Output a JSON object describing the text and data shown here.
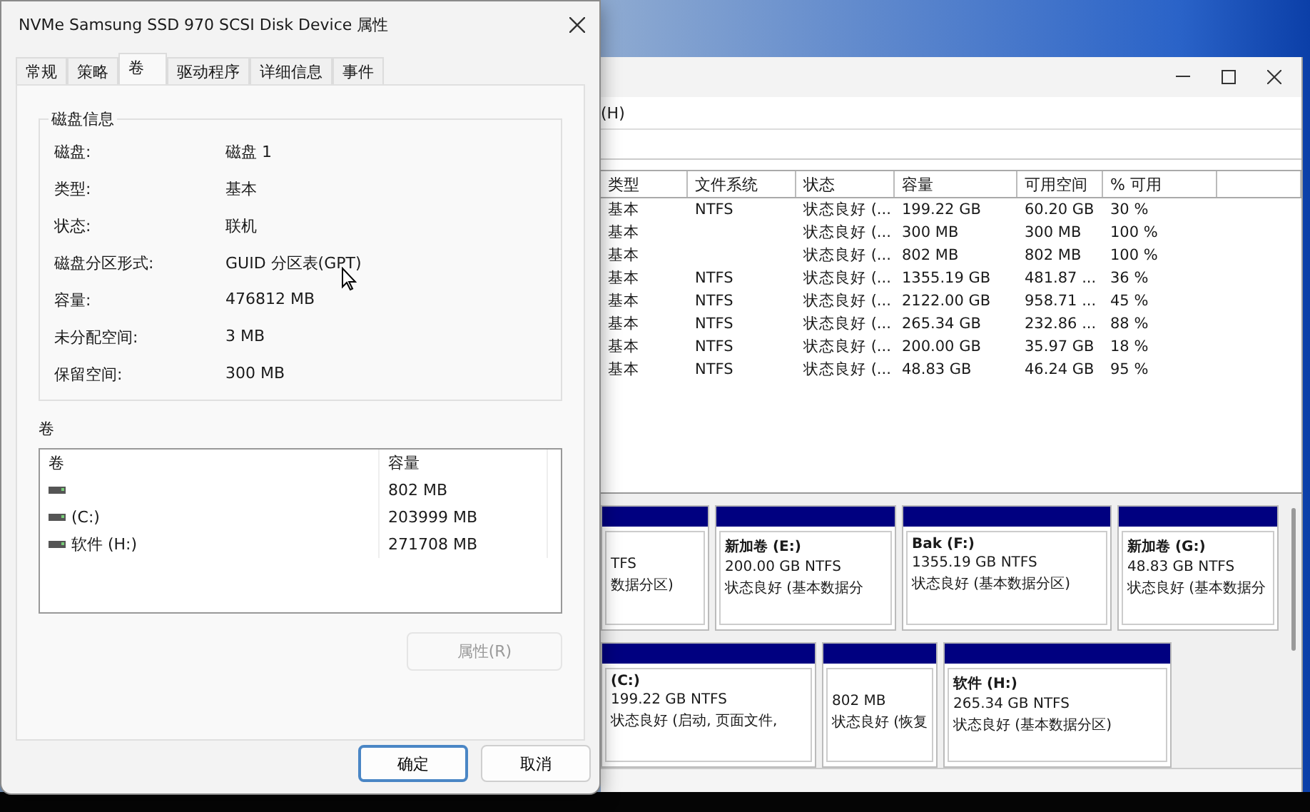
{
  "dialog": {
    "title": "NVMe Samsung SSD 970 SCSI Disk Device 属性",
    "tabs": [
      {
        "label": "常规",
        "selected": false
      },
      {
        "label": "策略",
        "selected": false
      },
      {
        "label": "卷",
        "selected": true
      },
      {
        "label": "驱动程序",
        "selected": false
      },
      {
        "label": "详细信息",
        "selected": false
      },
      {
        "label": "事件",
        "selected": false
      }
    ],
    "disk_info": {
      "title": "磁盘信息",
      "rows": [
        {
          "label": "磁盘:",
          "value": "磁盘 1"
        },
        {
          "label": "类型:",
          "value": "基本"
        },
        {
          "label": "状态:",
          "value": "联机"
        },
        {
          "label": "磁盘分区形式:",
          "value": "GUID 分区表(GPT)"
        },
        {
          "label": "容量:",
          "value": "476812 MB"
        },
        {
          "label": "未分配空间:",
          "value": "3 MB"
        },
        {
          "label": "保留空间:",
          "value": "300 MB"
        }
      ]
    },
    "volumes": {
      "title": "卷",
      "columns": [
        "卷",
        "容量"
      ],
      "rows": [
        {
          "capacity": "802 MB"
        },
        {
          "name": " (C:)",
          "capacity": "203999 MB"
        },
        {
          "name": "软件 (H:)",
          "capacity": "271708 MB"
        }
      ]
    },
    "properties_button": {
      "label": "属性(R)",
      "disabled": true
    },
    "buttons": [
      {
        "label": "确定",
        "default": true
      },
      {
        "label": "取消",
        "default": false
      }
    ]
  },
  "disk_window": {
    "menu_fragment": "(H)",
    "columns": [
      "类型",
      "文件系统",
      "状态",
      "容量",
      "可用空间",
      "% 可用"
    ],
    "rows": [
      [
        "基本",
        "NTFS",
        "状态良好 (...",
        "199.22 GB",
        "60.20 GB",
        "30 %"
      ],
      [
        "基本",
        "",
        "状态良好 (...",
        "300 MB",
        "300 MB",
        "100 %"
      ],
      [
        "基本",
        "",
        "状态良好 (...",
        "802 MB",
        "802 MB",
        "100 %"
      ],
      [
        "基本",
        "NTFS",
        "状态良好 (...",
        "1355.19 GB",
        "481.87 ...",
        "36 %"
      ],
      [
        "基本",
        "NTFS",
        "状态良好 (...",
        "2122.00 GB",
        "958.71 ...",
        "45 %"
      ],
      [
        "基本",
        "NTFS",
        "状态良好 (...",
        "265.34 GB",
        "232.86 ...",
        "88 %"
      ],
      [
        "基本",
        "NTFS",
        "状态良好 (...",
        "200.00 GB",
        "35.97 GB",
        "18 %"
      ],
      [
        "基本",
        "NTFS",
        "状态良好 (...",
        "48.83 GB",
        "46.24 GB",
        "95 %"
      ]
    ],
    "disks": [
      {
        "partitions": [
          {
            "size": "TFS",
            "status": "数据分区)"
          },
          {
            "name": "新加卷  (E:)",
            "size": "200.00 GB NTFS",
            "status": "状态良好 (基本数据分"
          },
          {
            "name": "Bak  (F:)",
            "size": "1355.19 GB NTFS",
            "status": "状态良好 (基本数据分区)"
          },
          {
            "name": "新加卷  (G:)",
            "size": "48.83 GB NTFS",
            "status": "状态良好 (基本数据分"
          }
        ]
      },
      {
        "partitions": [
          {
            "name": " (C:)",
            "size": "199.22 GB NTFS",
            "status": "状态良好 (启动, 页面文件,"
          },
          {
            "size": "802 MB",
            "status": "状态良好 (恢复"
          },
          {
            "name": "软件  (H:)",
            "size": "265.34 GB NTFS",
            "status": "状态良好 (基本数据分区)"
          }
        ]
      }
    ]
  }
}
